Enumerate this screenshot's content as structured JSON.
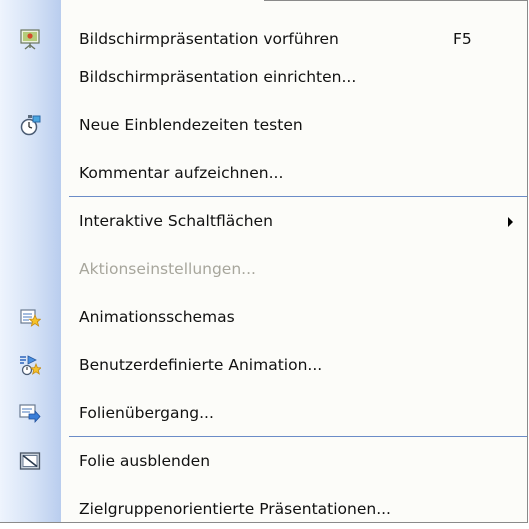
{
  "menu": {
    "items": [
      {
        "label": "Bildschirmpräsentation vorführen",
        "shortcut": "F5",
        "icon": "presentation-screen-icon",
        "enabled": true
      },
      {
        "label": "Bildschirmpräsentation einrichten...",
        "icon": "",
        "enabled": true
      },
      {
        "label": "Neue Einblendezeiten testen",
        "icon": "stopwatch-icon",
        "enabled": true
      },
      {
        "label": "Kommentar aufzeichnen...",
        "icon": "",
        "enabled": true
      },
      {
        "label": "Interaktive Schaltflächen",
        "icon": "",
        "enabled": true,
        "submenu": true
      },
      {
        "label": "Aktionseinstellungen...",
        "icon": "",
        "enabled": false
      },
      {
        "label": "Animationsschemas",
        "icon": "animation-scheme-star-icon",
        "enabled": true
      },
      {
        "label": "Benutzerdefinierte Animation...",
        "icon": "custom-animation-icon",
        "enabled": true
      },
      {
        "label": "Folienübergang...",
        "icon": "slide-transition-icon",
        "enabled": true
      },
      {
        "label": "Folie ausblenden",
        "icon": "hide-slide-icon",
        "enabled": true
      },
      {
        "label": "Zielgruppenorientierte Präsentationen...",
        "icon": "",
        "enabled": true
      }
    ]
  }
}
